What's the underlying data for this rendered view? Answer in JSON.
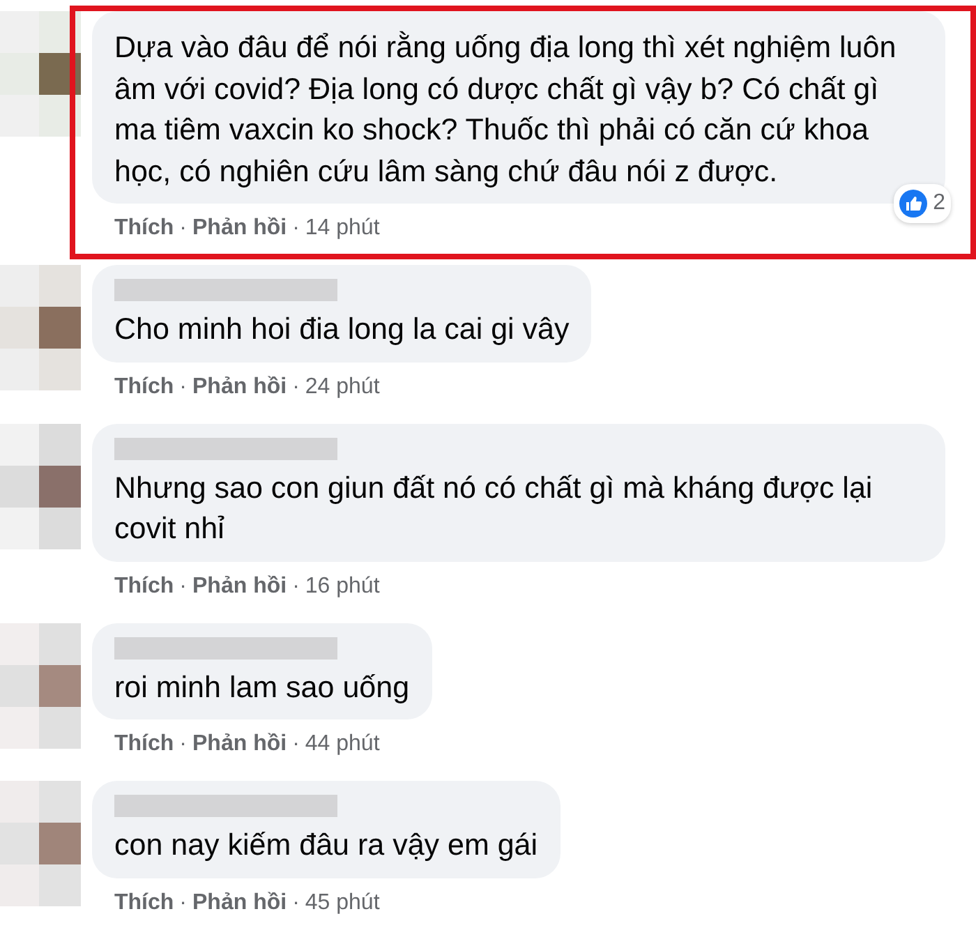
{
  "comments": [
    {
      "name_blurred": false,
      "highlighted": true,
      "text": "Dựa vào đâu để nói rằng uống địa long thì xét nghiệm luôn âm với covid? Địa long có dược chất gì vậy b? Có chất gì ma tiêm vaxcin ko shock? Thuốc thì phải có căn cứ khoa học, có nghiên cứu lâm sàng chứ đâu nói z được.",
      "like": "Thích",
      "separator_1": "·",
      "reply": "Phản hồi",
      "separator_2": "·",
      "time": "14 phút",
      "reactions": "2"
    },
    {
      "name_blurred": true,
      "highlighted": false,
      "text": "Cho minh hoi đia long la cai gi vây",
      "like": "Thích",
      "separator_1": "·",
      "reply": "Phản hồi",
      "separator_2": "·",
      "time": "24 phút"
    },
    {
      "name_blurred": true,
      "highlighted": false,
      "text": "Nhưng sao con giun đất nó có chất gì mà kháng được lại covit nhỉ",
      "like": "Thích",
      "separator_1": "·",
      "reply": "Phản hồi",
      "separator_2": "·",
      "time": "16 phút"
    },
    {
      "name_blurred": true,
      "highlighted": false,
      "text": "roi minh lam sao uống",
      "like": "Thích",
      "separator_1": "·",
      "reply": "Phản hồi",
      "separator_2": "·",
      "time": "44 phút"
    },
    {
      "name_blurred": true,
      "highlighted": false,
      "text": "con nay kiếm đâu ra vậy em gái",
      "like": "Thích",
      "separator_1": "·",
      "reply": "Phản hồi",
      "separator_2": "·",
      "time": "45 phút"
    }
  ]
}
